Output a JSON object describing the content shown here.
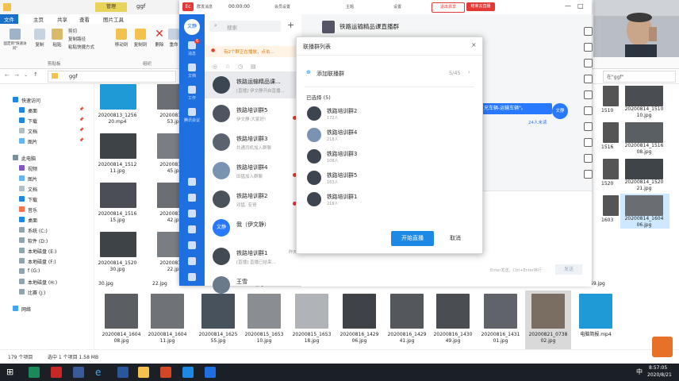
{
  "explorer": {
    "title": "ggf",
    "tabs": [
      "文件",
      "主页",
      "共享",
      "查看",
      "图片工具"
    ],
    "manage_tab": "管理",
    "ribbon": {
      "pin": "固定到\"快速访问\"",
      "copy": "复制",
      "paste": "粘贴",
      "cut": "剪切",
      "copy_path": "复制路径",
      "paste_shortcut": "粘贴快捷方式",
      "move_to": "移动到",
      "copy_to": "复制到",
      "delete": "删除",
      "rename": "重命",
      "group_clipboard": "剪贴板",
      "group_organize": "组织"
    },
    "address": "ggf",
    "search_hint": "在\"ggf\"",
    "nav": [
      {
        "label": "快速访问",
        "kind": "quick",
        "pinned": false
      },
      {
        "label": "桌面",
        "kind": "desktop",
        "pinned": true
      },
      {
        "label": "下载",
        "kind": "download",
        "pinned": true
      },
      {
        "label": "文档",
        "kind": "docs",
        "pinned": true
      },
      {
        "label": "图片",
        "kind": "pics",
        "pinned": true
      },
      {
        "label": "此电脑",
        "kind": "pc",
        "pinned": false
      },
      {
        "label": "视频",
        "kind": "video",
        "pinned": false
      },
      {
        "label": "图片",
        "kind": "pics",
        "pinned": false
      },
      {
        "label": "文档",
        "kind": "docs",
        "pinned": false
      },
      {
        "label": "下载",
        "kind": "download",
        "pinned": false
      },
      {
        "label": "音乐",
        "kind": "music",
        "pinned": false
      },
      {
        "label": "桌面",
        "kind": "desktop",
        "pinned": false
      },
      {
        "label": "系统 (C:)",
        "kind": "drive",
        "pinned": false
      },
      {
        "label": "软件 (D:)",
        "kind": "drive",
        "pinned": false
      },
      {
        "label": "本地磁盘 (E:)",
        "kind": "drive",
        "pinned": false
      },
      {
        "label": "本地磁盘 (F:)",
        "kind": "drive",
        "pinned": false
      },
      {
        "label": "f (G:)",
        "kind": "drive",
        "pinned": false
      },
      {
        "label": "本地磁盘 (H:)",
        "kind": "drive",
        "pinned": false
      },
      {
        "label": "比赛 (J:)",
        "kind": "drive",
        "pinned": false
      },
      {
        "label": "网络",
        "kind": "network",
        "pinned": false
      }
    ],
    "status_left": "179 个项目",
    "status_sel": "选中 1 个项目  1.58 MB",
    "files_left": [
      [
        "20200813_1256",
        "20.mp4"
      ],
      [
        "20200814_1",
        "53.jpg"
      ],
      [
        "20200814_1512",
        "11.jpg"
      ],
      [
        "20200814_1",
        "45.jpg"
      ],
      [
        "20200814_1516",
        "15.jpg"
      ],
      [
        "20200814_1",
        "42.jpg"
      ],
      [
        "20200814_1520",
        "30.jpg"
      ],
      [
        "20200814_1",
        "22.jpg"
      ]
    ],
    "files_right": [
      [
        "20200814_1510",
        "10.jpg"
      ],
      [
        "20200814_1516",
        "08.jpg"
      ],
      [
        "20200814_1520",
        "21.jpg"
      ],
      [
        "20200814_1604",
        "06.jpg"
      ]
    ],
    "files_right_partial": [
      "1510",
      "1516",
      "1520",
      "1603"
    ],
    "row_mid_captions": [
      "30.jpg",
      "22.jpg",
      "06.jpg",
      "34.jpg",
      "41.jpg",
      "22.jpg",
      "03.jpg",
      "07.jpg",
      "30.jpg",
      "59.jpg"
    ],
    "files_bottom": [
      [
        "20200814_1604",
        "08.jpg"
      ],
      [
        "20200814_1604",
        "11.jpg"
      ],
      [
        "20200814_1625",
        "55.jpg"
      ],
      [
        "20200815_1653",
        "10.jpg"
      ],
      [
        "20200815_1653",
        "18.jpg"
      ],
      [
        "20200816_1429",
        "06.jpg"
      ],
      [
        "20200816_1429",
        "41.jpg"
      ],
      [
        "20200816_1430",
        "49.jpg"
      ],
      [
        "20200816_1431",
        "01.jpg"
      ],
      [
        "20200821_0738",
        "02.jpg"
      ],
      [
        "电脑简报.mp4",
        ""
      ]
    ]
  },
  "client": {
    "top_items": [
      "Ec",
      "群发消息",
      "00:00:00",
      "会员设置",
      "主题",
      "设置",
      "退出共享",
      "结束云直播"
    ],
    "search_placeholder": "搜索",
    "notice": "有2个群正在播放，点击...",
    "sidebar": [
      {
        "label": "消息",
        "badge": "6"
      },
      {
        "label": "文档",
        "badge": ""
      },
      {
        "label": "工作",
        "badge": ""
      },
      {
        "label": "腾讯会议",
        "badge": ""
      }
    ],
    "my_avatar": "文静",
    "conversations": [
      {
        "name": "铁路运输精品课...",
        "preview": "[直播] 伊文静开启直播...",
        "time": "",
        "selected": true,
        "dot": false
      },
      {
        "name": "铁路培训群5",
        "preview": "伊文静:大家好!",
        "time": "",
        "selected": false,
        "dot": true
      },
      {
        "name": "铁路培训群3",
        "preview": "共通司机加入群聊",
        "time": "",
        "selected": false,
        "dot": false
      },
      {
        "name": "铁路培训群4",
        "preview": "田猛加入群聊",
        "time": "",
        "selected": false,
        "dot": true
      },
      {
        "name": "铁路培训群2",
        "preview": "邓猛: 宏哥",
        "time": "",
        "selected": false,
        "dot": true
      },
      {
        "name": "我（伊文静）",
        "preview": "",
        "time": "",
        "selected": false,
        "dot": false
      },
      {
        "name": "铁路培训群1",
        "preview": "[直播] 直播已结束...",
        "time": "昨天",
        "selected": false,
        "dot": false
      },
      {
        "name": "王雪",
        "preview": "",
        "time": "",
        "selected": false,
        "dot": false
      }
    ],
    "chat_title": "铁路运输精品课直播群",
    "chat_bubble": "兄车辆-运输车辆\"。",
    "chat_sub": "24人未读",
    "chat_input_hint": "Enter发送，Ctrl+Enter换行",
    "send_label": "发送"
  },
  "dialog": {
    "title": "联播群列表",
    "add_label": "添加联播群",
    "add_count": "5/45",
    "selected_label": "已选择 (5)",
    "groups": [
      {
        "name": "铁路培训群2",
        "count": "172人"
      },
      {
        "name": "铁路培训群4",
        "count": "218人"
      },
      {
        "name": "铁路培训群3",
        "count": "108人"
      },
      {
        "name": "铁路培训群5",
        "count": "163人"
      },
      {
        "name": "铁路培训群1",
        "count": "219人"
      }
    ],
    "start_label": "开始直播",
    "cancel_label": "取消"
  },
  "taskbar": {
    "time": "8:57:05",
    "date": "2020/8/21",
    "ime": "中"
  },
  "colors": {
    "accent": "#1e6fe0",
    "button": "#1e88e5",
    "record_red": "#e53935"
  }
}
